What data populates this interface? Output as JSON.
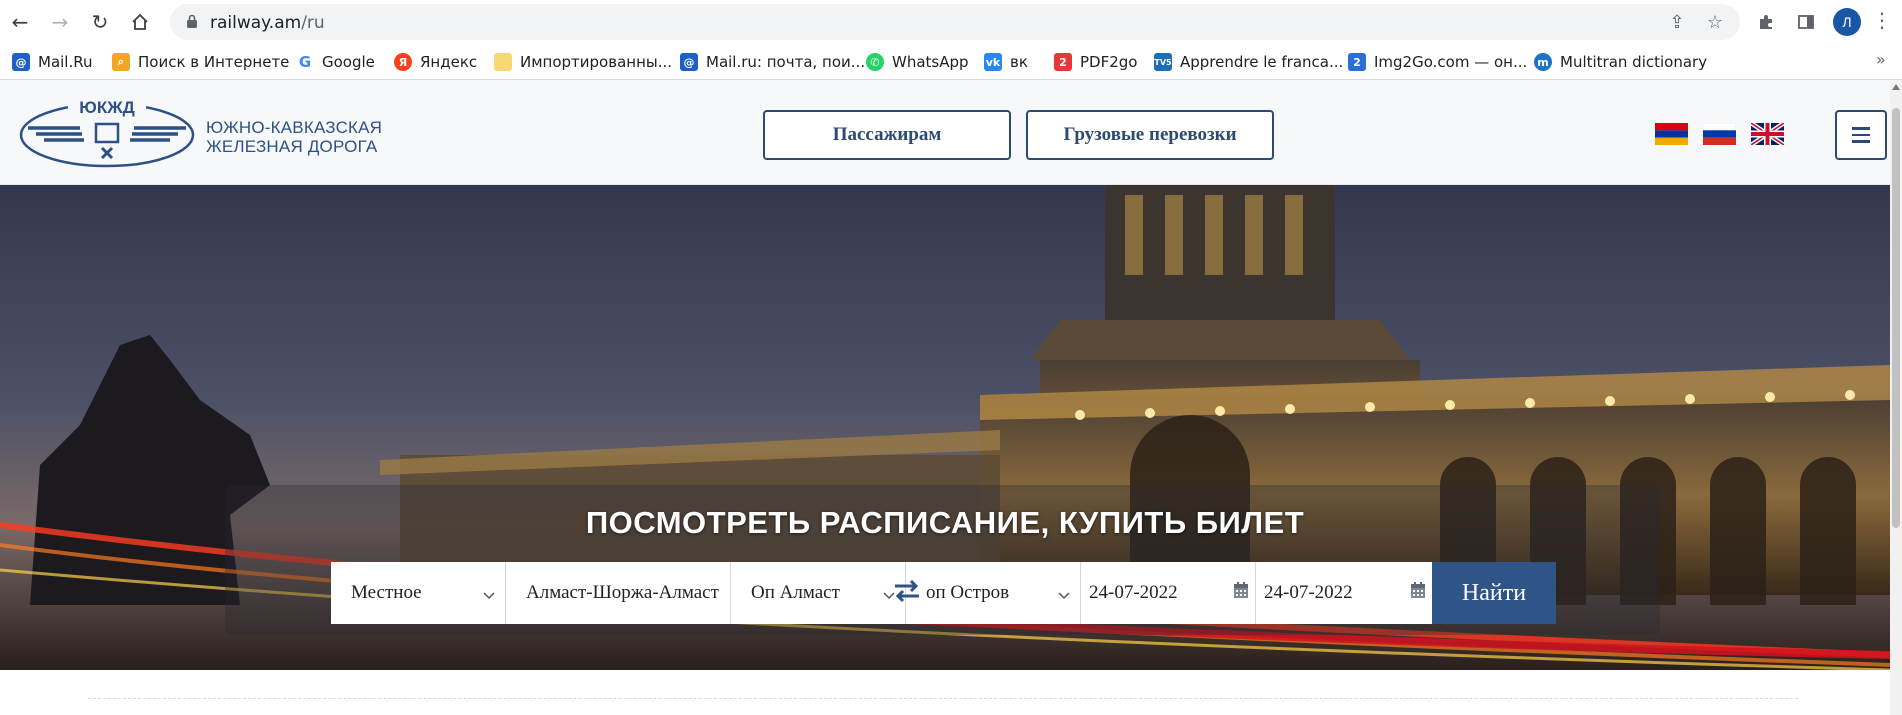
{
  "browser": {
    "url_host": "railway.am",
    "url_path": "/ru",
    "profile_initial": "Л",
    "bookmarks": [
      {
        "label": "Mail.Ru",
        "icon": "mailru-icon",
        "color": "#1e5fc8"
      },
      {
        "label": "Поиск в Интернете",
        "icon": "search-web-icon",
        "color": "#f5a623"
      },
      {
        "label": "Google",
        "icon": "google-icon",
        "color": "#4285f4"
      },
      {
        "label": "Яндекс",
        "icon": "yandex-icon",
        "color": "#fc3f1d"
      },
      {
        "label": "Импортированны...",
        "icon": "folder-icon",
        "color": "#f7d774"
      },
      {
        "label": "Mail.ru: почта, пои...",
        "icon": "mailru-icon",
        "color": "#1e5fc8"
      },
      {
        "label": "WhatsApp",
        "icon": "whatsapp-icon",
        "color": "#25d366"
      },
      {
        "label": "вк",
        "icon": "vk-icon",
        "color": "#2787f5"
      },
      {
        "label": "PDF2go",
        "icon": "pdf2go-icon",
        "color": "#e23a3a"
      },
      {
        "label": "Apprendre le franca...",
        "icon": "tv5-icon",
        "color": "#1c6fb5"
      },
      {
        "label": "Img2Go.com — он...",
        "icon": "img2go-icon",
        "color": "#2a6fd6"
      },
      {
        "label": "Multitran dictionary",
        "icon": "multitran-icon",
        "color": "#1d74c7"
      }
    ]
  },
  "site": {
    "logo_text": "ЮКЖД",
    "org_name_line1": "ЮЖНО-КАВКАЗСКАЯ",
    "org_name_line2": "ЖЕЛЕЗНАЯ ДОРОГА",
    "nav": {
      "passengers": "Пассажирам",
      "cargo": "Грузовые перевозки"
    },
    "languages": [
      "armenian-flag-icon",
      "russian-flag-icon",
      "uk-flag-icon"
    ],
    "colors": {
      "brand": "#2d4a72",
      "button": "#2f5487"
    }
  },
  "hero": {
    "title": "ПОСМОТРЕТЬ РАСПИСАНИЕ, КУПИТЬ БИЛЕТ",
    "search": {
      "type": "Местное",
      "route": "Алмаст-Шоржа-Алмаст",
      "from": "Оп Алмаст",
      "to": "оп Остров",
      "date_from": "24-07-2022",
      "date_to": "24-07-2022",
      "submit": "Найти"
    }
  }
}
